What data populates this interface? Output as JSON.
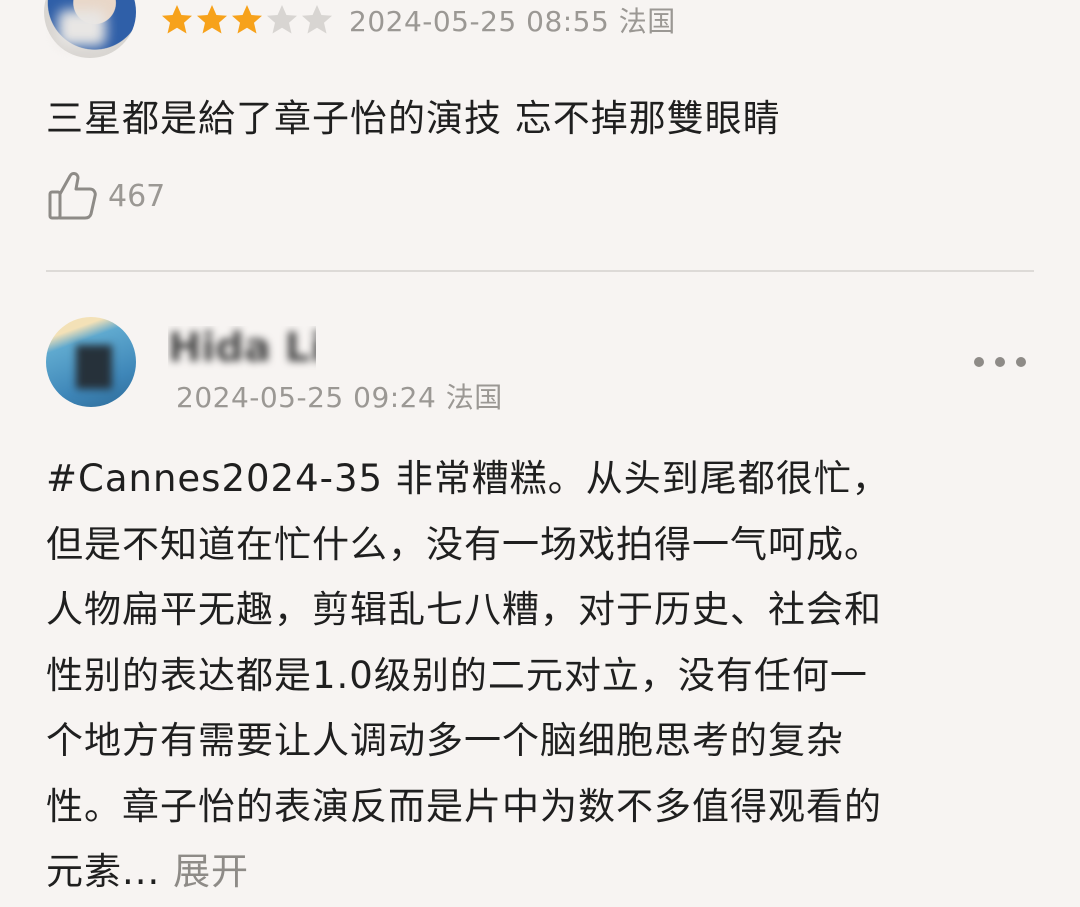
{
  "reviews": [
    {
      "rating": 3,
      "rating_max": 5,
      "date": "2024-05-25 08:55 法国",
      "text": "三星都是給了章子怡的演技 忘不掉那雙眼睛",
      "likes": "467"
    },
    {
      "username": "Hida Li",
      "date": "2024-05-25 09:24 法国",
      "text_lines": [
        "#Cannes2024-35 非常糟糕。从头到尾都很忙，",
        "但是不知道在忙什么，没有一场戏拍得一气呵成。",
        "人物扁平无趣，剪辑乱七八糟，对于历史、社会和",
        "性别的表达都是1.0级别的二元对立，没有任何一",
        "个地方有需要让人调动多一个脑细胞思考的复杂",
        "性。章子怡的表演反而是片中为数不多值得观看的"
      ],
      "last_line": "元素...",
      "expand_label": "展开"
    }
  ],
  "colors": {
    "star_filled": "#f7a21b",
    "star_empty": "#d8d5d2",
    "meta_text": "#9b9894",
    "background": "#f7f4f2"
  },
  "icons": {
    "like": "thumbs-up-icon",
    "more": "more-dots-icon"
  }
}
